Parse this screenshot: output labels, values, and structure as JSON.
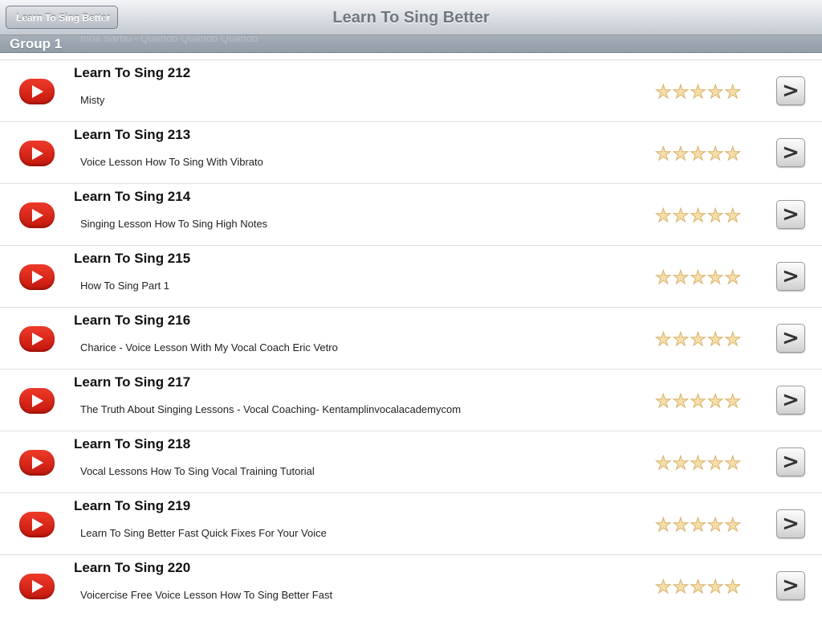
{
  "navbar": {
    "back_label": "Learn To Sing Better",
    "title": "Learn To Sing Better"
  },
  "section": {
    "title": "Group 1",
    "scrolled_text": "Inna Sarbu - Quando Quando Quando"
  },
  "rows": [
    {
      "title": "Learn To Sing 212",
      "subtitle": "Misty",
      "rating": "★★★★★"
    },
    {
      "title": "Learn To Sing 213",
      "subtitle": "Voice Lesson  How To Sing With Vibrato",
      "rating": "★★★★★"
    },
    {
      "title": "Learn To Sing 214",
      "subtitle": "Singing Lesson How To Sing High Notes",
      "rating": "★★★★★"
    },
    {
      "title": "Learn To Sing 215",
      "subtitle": "How To Sing Part 1",
      "rating": "★★★★★"
    },
    {
      "title": "Learn To Sing 216",
      "subtitle": "Charice - Voice Lesson With My Vocal Coach Eric Vetro",
      "rating": "★★★★★"
    },
    {
      "title": "Learn To Sing 217",
      "subtitle": "The Truth About Singing Lessons -  Vocal Coaching- Kentamplinvocalacademycom",
      "rating": "★★★★★"
    },
    {
      "title": "Learn To Sing 218",
      "subtitle": "Vocal Lessons How To Sing Vocal Training Tutorial",
      "rating": "★★★★★"
    },
    {
      "title": "Learn To Sing 219",
      "subtitle": "Learn To Sing Better Fast Quick Fixes For Your Voice",
      "rating": "★★★★★"
    },
    {
      "title": "Learn To Sing 220",
      "subtitle": "Voicercise Free Voice Lesson How To Sing Better Fast",
      "rating": "★★★★★"
    }
  ],
  "disclosure_glyph": ">",
  "icons": {
    "play": "play-icon",
    "star": "star-icon",
    "disclosure": "chevron-right-icon"
  },
  "colors": {
    "play_red": "#d81e10",
    "star_fill": "#f6deaa"
  }
}
